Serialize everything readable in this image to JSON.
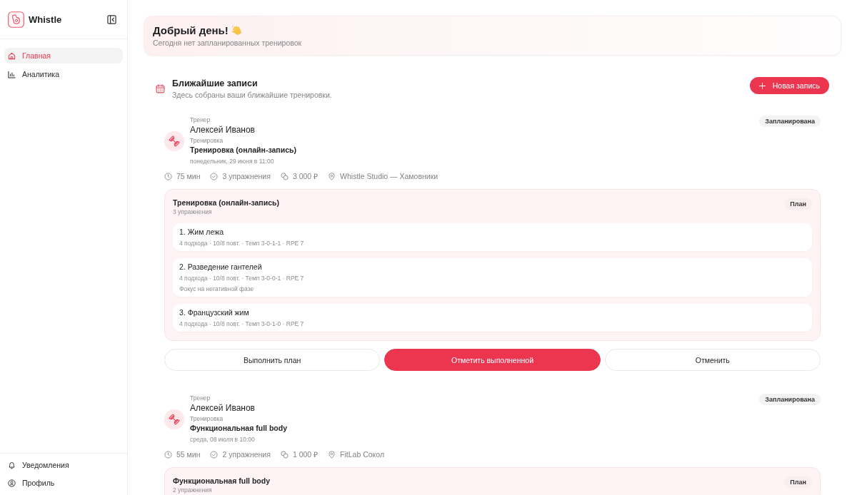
{
  "sidebar": {
    "brand": "Whistle",
    "nav": [
      {
        "label": "Главная",
        "selected": true
      },
      {
        "label": "Аналитика",
        "selected": false
      }
    ],
    "footer": [
      {
        "label": "Уведомления"
      },
      {
        "label": "Профиль"
      }
    ]
  },
  "greeting": {
    "title": "Добрый день!",
    "subtitle": "Сегодня нет запланированных тренировок"
  },
  "upcoming": {
    "title": "Ближайшие записи",
    "subtitle": "Здесь собраны ваши ближайшие тренировки.",
    "new_button": "Новая запись",
    "bookings": [
      {
        "trainer_label": "Тренер",
        "trainer": "Алексей Иванов",
        "workout_label": "Тренировка",
        "workout": "Тренировка (онлайн-запись)",
        "date": "понедельник, 29 июня в 11:00",
        "status": "Запланирована",
        "meta": [
          {
            "kind": "duration",
            "text": "75 мин"
          },
          {
            "kind": "exercises",
            "text": "3 упражнения"
          },
          {
            "kind": "price",
            "text": "3 000 ₽"
          },
          {
            "kind": "location",
            "text": "Whistle Studio — Хамовники"
          }
        ],
        "plan": {
          "title": "Тренировка (онлайн-запись)",
          "count": "3 упражнения",
          "badge": "План",
          "exercises": [
            {
              "name": "1. Жим лежа",
              "details": "4 подхода · 10/8 повт. · Темп 3-0-1-1 · RPE 7"
            },
            {
              "name": "2. Разведение гантелей",
              "details": "4 подхода · 10/8 повт. · Темп 3-0-0-1 · RPE 7",
              "note": "Фокус на негативной фазе"
            },
            {
              "name": "3. Французский жим",
              "details": "4 подхода · 10/8 повт. · Темп 3-0-1-0 · RPE 7"
            }
          ]
        },
        "actions": [
          {
            "label": "Выполнить план",
            "kind": "secondary"
          },
          {
            "label": "Отметить выполненной",
            "kind": "primary"
          },
          {
            "label": "Отменить",
            "kind": "secondary"
          }
        ]
      },
      {
        "trainer_label": "Тренер",
        "trainer": "Алексей Иванов",
        "workout_label": "Тренировка",
        "workout": "Функциональная full body",
        "date": "среда, 08 июля в 10:00",
        "status": "Запланирована",
        "meta": [
          {
            "kind": "duration",
            "text": "55 мин"
          },
          {
            "kind": "exercises",
            "text": "2 упражнения"
          },
          {
            "kind": "price",
            "text": "1 000 ₽"
          },
          {
            "kind": "location",
            "text": "FitLab Сокол"
          }
        ],
        "plan": {
          "title": "Функциональная full body",
          "count": "2 упражнения",
          "badge": "План"
        }
      }
    ]
  }
}
